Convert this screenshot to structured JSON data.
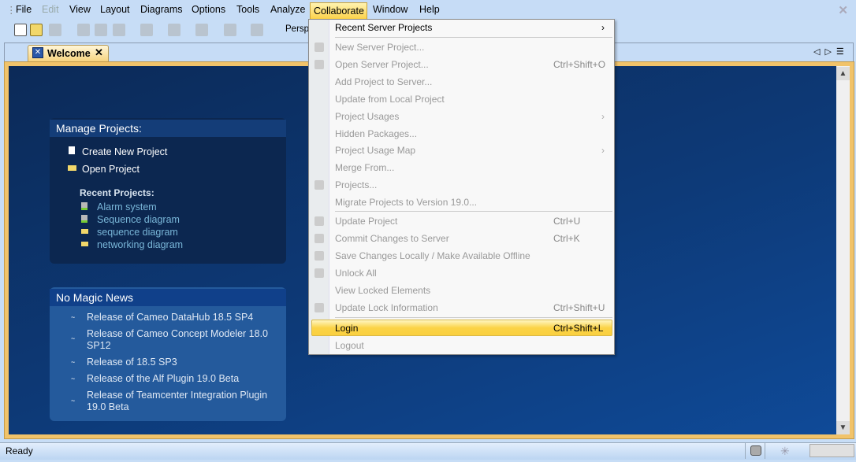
{
  "menubar": {
    "items": [
      "File",
      "Edit",
      "View",
      "Layout",
      "Diagrams",
      "Options",
      "Tools",
      "Analyze",
      "Collaborate",
      "Window",
      "Help"
    ],
    "disabled": [
      "Edit"
    ],
    "active": "Collaborate"
  },
  "toolbar": {
    "perspective_label": "Persp"
  },
  "tab": {
    "label": "Welcome",
    "close": "✕"
  },
  "manage": {
    "title": "Manage Projects:",
    "create": "Create New Project",
    "open": "Open Project",
    "recent_title": "Recent Projects:",
    "recent": [
      "Alarm system",
      "Sequence diagram",
      "sequence diagram",
      "networking diagram"
    ]
  },
  "news": {
    "title": "No Magic News",
    "items": [
      "Release of Cameo DataHub 18.5 SP4",
      "Release of Cameo Concept Modeler 18.0 SP12",
      "Release of 18.5 SP3",
      "Release of the Alf Plugin 19.0 Beta",
      "Release of Teamcenter Integration Plugin 19.0 Beta"
    ]
  },
  "collab_menu": {
    "items": [
      {
        "label": "Recent Server Projects",
        "enabled": true,
        "submenu": true
      },
      {
        "label": "New Server Project..."
      },
      {
        "label": "Open Server Project...",
        "shortcut": "Ctrl+Shift+O"
      },
      {
        "label": "Add Project to Server..."
      },
      {
        "label": "Update from Local Project"
      },
      {
        "label": "Project Usages",
        "submenu": true
      },
      {
        "label": "Hidden Packages..."
      },
      {
        "label": "Project Usage Map",
        "submenu": true
      },
      {
        "label": "Merge From..."
      },
      {
        "label": "Projects..."
      },
      {
        "label": "Migrate Projects to Version 19.0..."
      },
      {
        "label": "Update Project",
        "shortcut": "Ctrl+U"
      },
      {
        "label": "Commit Changes to Server",
        "shortcut": "Ctrl+K"
      },
      {
        "label": "Save Changes Locally / Make Available Offline"
      },
      {
        "label": "Unlock All"
      },
      {
        "label": "View Locked Elements"
      },
      {
        "label": "Update Lock Information",
        "shortcut": "Ctrl+Shift+U"
      },
      {
        "label": "Login",
        "shortcut": "Ctrl+Shift+L",
        "enabled": true,
        "highlighted": true
      },
      {
        "label": "Logout"
      }
    ]
  },
  "status": {
    "text": "Ready"
  }
}
